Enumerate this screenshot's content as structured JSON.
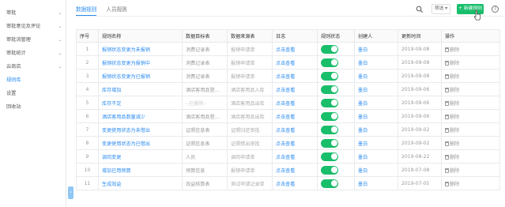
{
  "sidebar": {
    "items": [
      {
        "label": "审批",
        "chevron": "⌄"
      },
      {
        "label": "审批意见及评论",
        "chevron": "⌄"
      },
      {
        "label": "审批流管理",
        "chevron": "⌄"
      },
      {
        "label": "审批统计",
        "chevron": "⌄"
      },
      {
        "label": "云商店",
        "chevron": "⌄"
      },
      {
        "label": "规则库",
        "chevron": ""
      },
      {
        "label": "设置",
        "chevron": ""
      },
      {
        "label": "回收站",
        "chevron": ""
      }
    ],
    "active_index": 5,
    "collapse_glyph": "‹"
  },
  "tabs": [
    {
      "label": "数据规则"
    },
    {
      "label": "人员规则"
    }
  ],
  "toolbar": {
    "filter_label": "筛选 ▾",
    "new_label": "+ 新建规则",
    "help_label": "?"
  },
  "table": {
    "headers": [
      "序号",
      "规则名称",
      "数据目标表",
      "数据来源表",
      "日志",
      "规则状态",
      "创建人",
      "更新时间",
      "操作"
    ],
    "rows": [
      {
        "idx": "1",
        "name": "报销状态变更为未报销",
        "target": "消费记录表",
        "source": "报销申请单",
        "log": "点击查看",
        "creator": "墨白",
        "time": "2019-09-08",
        "op": "删除"
      },
      {
        "idx": "2",
        "name": "报销状态变更为报销中",
        "target": "消费记录表",
        "source": "报销申请单",
        "log": "点击查看",
        "creator": "墨白",
        "time": "2019-09-08",
        "op": "删除"
      },
      {
        "idx": "3",
        "name": "报销状态变更为已报销",
        "target": "消费记录表",
        "source": "报销申请单",
        "log": "点击查看",
        "creator": "墨白",
        "time": "2019-09-08",
        "op": "删除"
      },
      {
        "idx": "4",
        "name": "库存增加",
        "target": "酒店客用品登...",
        "source": "酒店客用品入库",
        "log": "点击查看",
        "creator": "墨白",
        "time": "2019-09-06",
        "op": "删除"
      },
      {
        "idx": "5",
        "name": "库存不足",
        "target": "--已删除--",
        "source": "酒店客用品出库",
        "log": "点击查看",
        "creator": "墨白",
        "time": "2019-09-06",
        "op": "删除"
      },
      {
        "idx": "6",
        "name": "酒店客用品数量减少",
        "target": "酒店客用品登...",
        "source": "酒店客用品出库",
        "log": "点击查看",
        "creator": "墨白",
        "time": "2019-09-06",
        "op": "删除"
      },
      {
        "idx": "7",
        "name": "变更使用状态为未借出",
        "target": "证照信息表",
        "source": "证照归还审批",
        "log": "点击查看",
        "creator": "墨白",
        "time": "2019-09-02",
        "op": "删除"
      },
      {
        "idx": "8",
        "name": "变更使用状态为已借出",
        "target": "证照信息表",
        "source": "证照借出审批",
        "log": "点击查看",
        "creator": "墨白",
        "time": "2019-09-02",
        "op": "删除"
      },
      {
        "idx": "9",
        "name": "调岗变更",
        "target": "人员",
        "source": "调岗申请单",
        "log": "点击查看",
        "creator": "墨白",
        "time": "2019-08-22",
        "op": "删除"
      },
      {
        "idx": "10",
        "name": "增加已用预算",
        "target": "预算信息",
        "source": "报销申请单",
        "log": "点击查看",
        "creator": "墨白",
        "time": "2019-07-08",
        "op": "删除"
      },
      {
        "idx": "11",
        "name": "生成效益",
        "target": "效益核算表",
        "source": "测试申请记录单",
        "log": "点击查看",
        "creator": "墨白",
        "time": "2019-07-05",
        "op": "删除"
      }
    ]
  },
  "colors": {
    "accent": "#2d8cf0",
    "toggle_on": "#19be6b",
    "new_button": "#19be6b"
  }
}
